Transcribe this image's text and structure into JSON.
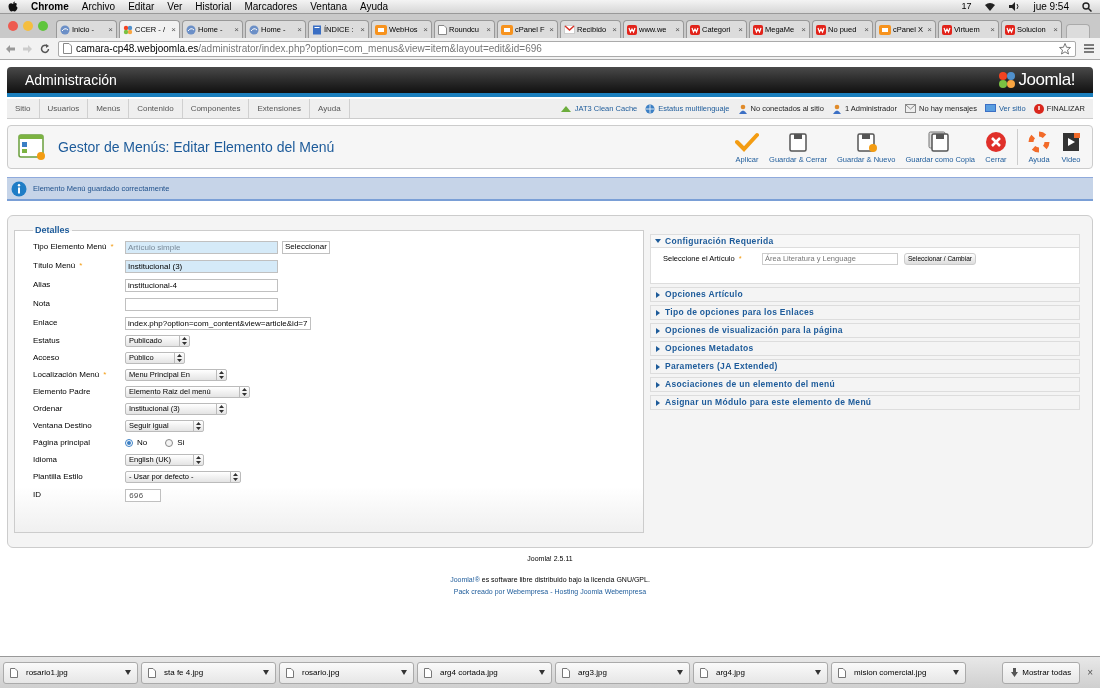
{
  "menubar": {
    "app": "Chrome",
    "menus": [
      "Archivo",
      "Editar",
      "Ver",
      "Historial",
      "Marcadores",
      "Ventana",
      "Ayuda"
    ],
    "indicator": "17",
    "clock": "jue 9:54"
  },
  "browser": {
    "tabs": [
      {
        "title": "Inicio - ",
        "kind": "globe",
        "close": "×",
        "selected": false
      },
      {
        "title": "CCER - /",
        "kind": "joomla",
        "close": "×",
        "selected": true
      },
      {
        "title": "Home - ",
        "kind": "globe",
        "close": "×",
        "selected": false
      },
      {
        "title": "Home - ",
        "kind": "globe",
        "close": "×",
        "selected": false
      },
      {
        "title": "ÍNDICE :",
        "kind": "document",
        "close": "×",
        "selected": false
      },
      {
        "title": "WebHos",
        "kind": "cpanel",
        "close": "×",
        "selected": false
      },
      {
        "title": "Roundcu",
        "kind": "page",
        "close": "×",
        "selected": false
      },
      {
        "title": "cPanel F",
        "kind": "cpanel",
        "close": "×",
        "selected": false
      },
      {
        "title": "Recibido",
        "kind": "mail",
        "close": "×",
        "selected": false
      },
      {
        "title": "www.we",
        "kind": "webempresa",
        "close": "×",
        "selected": false
      },
      {
        "title": "Categori",
        "kind": "webempresa",
        "close": "×",
        "selected": false
      },
      {
        "title": "MegaMe",
        "kind": "webempresa",
        "close": "×",
        "selected": false
      },
      {
        "title": "No pued",
        "kind": "webempresa",
        "close": "×",
        "selected": false
      },
      {
        "title": "cPanel X",
        "kind": "cpanel",
        "close": "×",
        "selected": false
      },
      {
        "title": "Virtuem",
        "kind": "webempresa",
        "close": "×",
        "selected": false
      },
      {
        "title": "Solucion",
        "kind": "webempresa",
        "close": "×",
        "selected": false
      }
    ],
    "url_host": "camara-cp48.webjoomla.es",
    "url_path": "/administrator/index.php?option=com_menus&view=item&layout=edit&id=696"
  },
  "header": {
    "title": "Administración",
    "logo": "Joomla!"
  },
  "nav": [
    "Sitio",
    "Usuarios",
    "Menús",
    "Contenido",
    "Componentes",
    "Extensiones",
    "Ayuda"
  ],
  "status": [
    {
      "label": "JAT3 Clean Cache",
      "kind": "cache"
    },
    {
      "label": "Estatus multilenguaje",
      "kind": "globe"
    },
    {
      "label": "No conectados al sitio",
      "kind": "user"
    },
    {
      "label": "1 Administrador",
      "kind": "user"
    },
    {
      "label": "No hay mensajes",
      "kind": "mail"
    },
    {
      "label": "Ver sitio",
      "kind": "monitor"
    },
    {
      "label": "FINALIZAR",
      "kind": "logout"
    }
  ],
  "toolbar": {
    "title": "Gestor de Menús: Editar Elemento del Menú",
    "buttons": [
      {
        "label": "Aplicar",
        "kind": "check"
      },
      {
        "label": "Guardar & Cerrar",
        "kind": "save"
      },
      {
        "label": "Guardar & Nuevo",
        "kind": "save-new"
      },
      {
        "label": "Guardar como Copia",
        "kind": "save-copy"
      },
      {
        "label": "Cerrar",
        "kind": "close"
      },
      {
        "label": "Ayuda",
        "kind": "help"
      },
      {
        "label": "Video",
        "kind": "video"
      }
    ]
  },
  "message": "Elemento Menú guardado correctamente",
  "required_mark": "*",
  "details": {
    "legend": "Detalles",
    "fields": [
      {
        "label": "Tipo Elemento Menú",
        "kind": "text",
        "required": true,
        "highlighted": true,
        "readonly": true,
        "value": "Artículo simple",
        "button": "Seleccionar"
      },
      {
        "label": "Título Menú",
        "kind": "text",
        "required": true,
        "highlighted": true,
        "readonly": false,
        "value": "Institucional (3)"
      },
      {
        "label": "Alias",
        "kind": "text",
        "required": false,
        "highlighted": false,
        "readonly": false,
        "value": "institucional-4"
      },
      {
        "label": "Nota",
        "kind": "text",
        "required": false,
        "highlighted": false
      },
      {
        "label": "Enlace",
        "kind": "text",
        "required": false,
        "highlighted": false,
        "readonly": false,
        "value": "index.php?option=com_content&view=article&id=7"
      },
      {
        "label": "Estatus",
        "kind": "select",
        "required": false,
        "value": "Publicado"
      },
      {
        "label": "Acceso",
        "kind": "select",
        "required": false,
        "value": "Público"
      },
      {
        "label": "Localización Menú",
        "kind": "select",
        "required": true,
        "value": "Menu Principal En"
      },
      {
        "label": "Elemento Padre",
        "kind": "select",
        "required": false,
        "value": "Elemento Raiz del menú"
      },
      {
        "label": "Ordenar",
        "kind": "select",
        "required": false,
        "value": "Institucional (3)"
      },
      {
        "label": "Ventana Destino",
        "kind": "select",
        "required": false,
        "value": "Seguir igual"
      },
      {
        "label": "Página principal",
        "kind": "radio",
        "required": false,
        "options": [
          {
            "label": "No",
            "selected": true
          },
          {
            "label": "Si",
            "selected": false
          }
        ]
      },
      {
        "label": "Idioma",
        "kind": "select",
        "required": false,
        "value": "English (UK)"
      },
      {
        "label": "Plantilla Estilo",
        "kind": "select",
        "required": false,
        "value": "- Usar por defecto -"
      },
      {
        "label": "ID",
        "kind": "id",
        "required": false,
        "value": "696"
      }
    ]
  },
  "options": [
    {
      "title": "Configuración Requerida",
      "expanded": true,
      "field": {
        "label": "Seleccione el Artículo",
        "required": true,
        "value": "Área Literatura y Lenguage",
        "button": "Seleccionar / Cambiar"
      }
    },
    {
      "title": "Opciones Artículo",
      "expanded": false
    },
    {
      "title": "Tipo de opciones para los Enlaces",
      "expanded": false
    },
    {
      "title": "Opciones de visualización para la página",
      "expanded": false
    },
    {
      "title": "Opciones Metadatos",
      "expanded": false
    },
    {
      "title": "Parameters (JA Extended)",
      "expanded": false
    },
    {
      "title": "Asociaciones de un elemento del menú",
      "expanded": false
    },
    {
      "title": "Asignar un Módulo para este elemento de Menú",
      "expanded": false
    }
  ],
  "footer": {
    "version": "Joomla! 2.5.11",
    "license_link": "Joomla!®",
    "license_text": " es software libre distribuido bajo la licencia GNU/GPL.",
    "pack_link": "Pack creado por Webempresa",
    "separator": " - ",
    "hosting_link": "Hosting Joomla Webempresa"
  },
  "downloads": {
    "files": [
      "rosario1.jpg",
      "sta fe 4.jpg",
      "rosario.jpg",
      "arg4 cortada.jpg",
      "arg3.jpg",
      "arg4.jpg",
      "mision comercial.jpg"
    ],
    "show_all": "Mostrar todas",
    "close": "×"
  }
}
